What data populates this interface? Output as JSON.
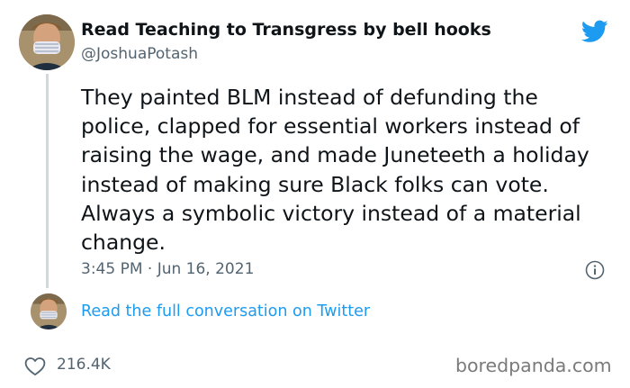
{
  "tweet": {
    "display_name": "Read Teaching to Transgress by bell hooks",
    "handle": "@JoshuaPotash",
    "text": "They painted BLM instead of defunding the police, clapped for essential workers instead of raising the wage, and made Juneteeth a holiday instead of making sure Black folks can vote. Always a symbolic victory instead of a material change.",
    "timestamp": "3:45 PM · Jun 16, 2021",
    "like_count": "216.4K"
  },
  "reply": {
    "link_label": "Read the full conversation on Twitter"
  },
  "watermark": "boredpanda.com",
  "icons": {
    "brand": "twitter-bird-icon",
    "info": "info-icon",
    "like": "heart-icon"
  },
  "colors": {
    "twitter_blue": "#1d9bf0",
    "secondary_text": "#536471",
    "thread_line": "#cfd9de"
  }
}
